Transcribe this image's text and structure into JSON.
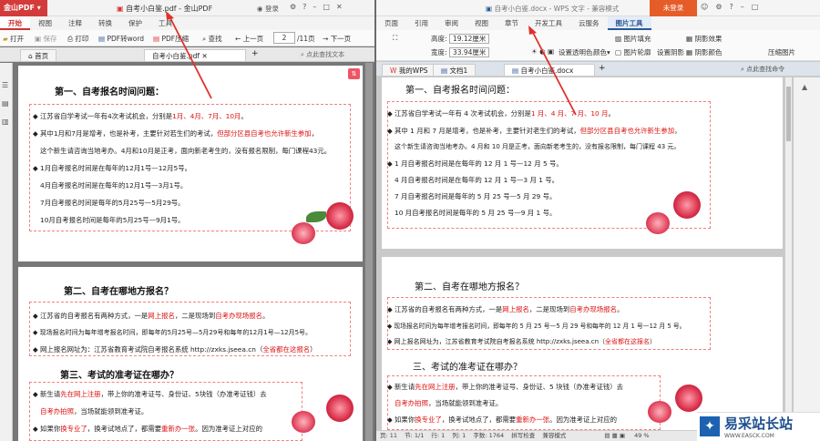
{
  "left": {
    "app_badge": "金山PDF",
    "title": "自考小白鉴.pdf - 金山PDF",
    "login": "登录",
    "tabs": [
      "开始",
      "视图",
      "注释",
      "转换",
      "保护",
      "工具"
    ],
    "tools": {
      "open": "打开",
      "save": "保存",
      "print": "打印",
      "to_word": "PDF转word",
      "compress": "PDF压缩",
      "find": "查找",
      "prev": "上一页",
      "page_value": "2",
      "page_total": "/11页",
      "next": "下一页"
    },
    "doc_tabs": {
      "home": "首页",
      "file": "自考小白鉴.pdf",
      "search": "点此查找文本"
    },
    "page1": {
      "heading": "第一、自考报名时间问题：",
      "lines": [
        {
          "a": "◆ 江苏省自学考试一年有4次考试机会，分别是",
          "b": "1月、4月、7月、10月",
          "c": "。"
        },
        {
          "a": "◆ 其中1月和7月是增考，也是补考，主要针对若生们的考试，",
          "b": "但部分区县自考也允许新生参加",
          "c": "，"
        },
        {
          "a": "这个新生请咨询当地考办。4月和10月是正考，面向新老考生的，没有报名限制，每门课程43元。",
          "b": "",
          "c": ""
        },
        {
          "a": "◆ 1月自考报名时间是在每年的12月1号—12月5号。",
          "b": "",
          "c": ""
        },
        {
          "a": "4月自考报名时间是在每年的12月1号—3月1号。",
          "b": "",
          "c": ""
        },
        {
          "a": "7月自考报名时间是每年的5月25号—5月29号。",
          "b": "",
          "c": ""
        },
        {
          "a": "10月自考报名时间是每年的5月25号—9月1号。",
          "b": "",
          "c": ""
        }
      ]
    },
    "page2": {
      "heading": "第二、自考在哪地方报名？",
      "lines": [
        {
          "a": "◆ 江苏省的自考报名有两种方式，一是",
          "b": "网上报名",
          "c": "，二是现场到",
          "d": "自考办现场报名",
          "e": "。"
        },
        {
          "a": "◆ 现场报名时间为每年增考报名时间，即每年的5月25号—5月29号和每年的12月1号—12月5号。",
          "b": "",
          "c": "",
          "d": "",
          "e": ""
        },
        {
          "a": "◆ 网上报名网址为：江苏省教育考试院自考报名系统 http://zxks.jseea.cn（",
          "b": "全省都在这报名",
          "c": "）",
          "d": "",
          "e": ""
        }
      ],
      "heading2": "第三、考试的准考证在哪办？",
      "lines2": [
        {
          "a": "◆ 新生请",
          "b": "先在网上注册",
          "c": "，带上你的准考证号、身份证、5块钱（办准考证钱）去"
        },
        {
          "a": "",
          "b": "自考办拍照",
          "c": "，当场就能领到准考证。"
        },
        {
          "a": "◆ 如果你",
          "b": "换专业了",
          "c": "，换考试地点了，都需要",
          "d": "重新办一张",
          "e": "。因为准考证上对应的"
        }
      ]
    }
  },
  "right": {
    "tabs": [
      "页面",
      "引用",
      "审阅",
      "视图",
      "章节",
      "开发工具",
      "云服务",
      "图片工具"
    ],
    "title": "自考小白鉴.docx - WPS 文字 - 兼容模式",
    "unlogged": "未登录",
    "tools": {
      "height_label": "高度:",
      "height_value": "19.12厘米",
      "width_label": "宽度:",
      "width_value": "33.94厘米",
      "transparent": "设置透明色",
      "color": "颜色",
      "fill": "图片填充",
      "outline": "图片轮廓",
      "shadow_effect": "阴影效果",
      "shadow_color": "阴影颜色",
      "set_shadow": "设置阴影",
      "compress": "压缩图片"
    },
    "doc_tabs": {
      "wps": "我的WPS",
      "doc1": "文档1",
      "file": "自考小白鉴.docx",
      "search": "点此查找命令"
    },
    "page1": {
      "heading": "第一、自考报名时间问题：",
      "lines": [
        {
          "a": "◆ 江苏省自学考试一年有 4 次考试机会，分别是",
          "b": "1 月、4 月、7 月、10 月",
          "c": "。"
        },
        {
          "a": "◆ 其中 1 月和 7 月是增考，也是补考，主要针对老生们的考试，",
          "b": "但部分区县自考也允许新生参加",
          "c": "，"
        },
        {
          "a": "这个新生请咨询当地考办。4 月和 10 月是正考，面向新老考生的，没有报名限制，每门课程 43 元。",
          "b": "",
          "c": ""
        },
        {
          "a": "◆ 1 月自考报名时间是在每年的 12 月 1 号—12 月 5 号。",
          "b": "",
          "c": ""
        },
        {
          "a": "4 月自考报名时间是在每年的 12 月 1 号—3 月 1 号。",
          "b": "",
          "c": ""
        },
        {
          "a": "7 月自考报名时间是每年的 5 月 25 号—5 月 29 号。",
          "b": "",
          "c": ""
        },
        {
          "a": "10 月自考报名时间是每年的 5 月 25 号—9 月 1 号。",
          "b": "",
          "c": ""
        }
      ]
    },
    "page2": {
      "heading": "第二、自考在哪地方报名？",
      "lines": [
        {
          "a": "◆ 江苏省的自考报名有两种方式，一是",
          "b": "网上报名",
          "c": "，二是现场到",
          "d": "自考办现场报名",
          "e": "。"
        },
        {
          "a": "◆ 现场报名时间为每年增考报名时间，即每年的 5 月 25 号—5 月 29 号和每年的 12 月 1 号—12 月 5 号。",
          "b": "",
          "c": "",
          "d": "",
          "e": ""
        },
        {
          "a": "◆ 网上报名网址为，江苏省教育考试院自考报名系统 http://zxks.jseea.cn（",
          "b": "全省都在这报名",
          "c": "）",
          "d": "",
          "e": ""
        }
      ],
      "heading2": "三、考试的准考证在哪办？",
      "lines2": [
        {
          "a": "◆ 新生请",
          "b": "先在网上注册",
          "c": "，带上你的准考证号、身份证、5 块钱（办准考证钱）去"
        },
        {
          "a": "",
          "b": "自考办拍照",
          "c": "，当场就能领到准考证。"
        },
        {
          "a": "◆ 如果你",
          "b": "换专业了",
          "c": "，换考试地点了，都需要",
          "d": "重新办一张",
          "e": "。因为准考证上对应的"
        }
      ]
    },
    "status": {
      "page": "页: 11",
      "section": "节: 1/1",
      "rows": "行: 1",
      "col": "列: 1",
      "chars": "字数: 1764",
      "spell": "拼写检查",
      "mode": "兼容模式",
      "zoom": "49 %"
    }
  },
  "watermark": {
    "text": "易采站长站",
    "sub": "WWW.EASCK.COM"
  },
  "colors": {
    "pdf_red": "#d33b3b",
    "wps_orange": "#e65c28",
    "annot_red": "#d11",
    "arrow": "#e0302a"
  }
}
